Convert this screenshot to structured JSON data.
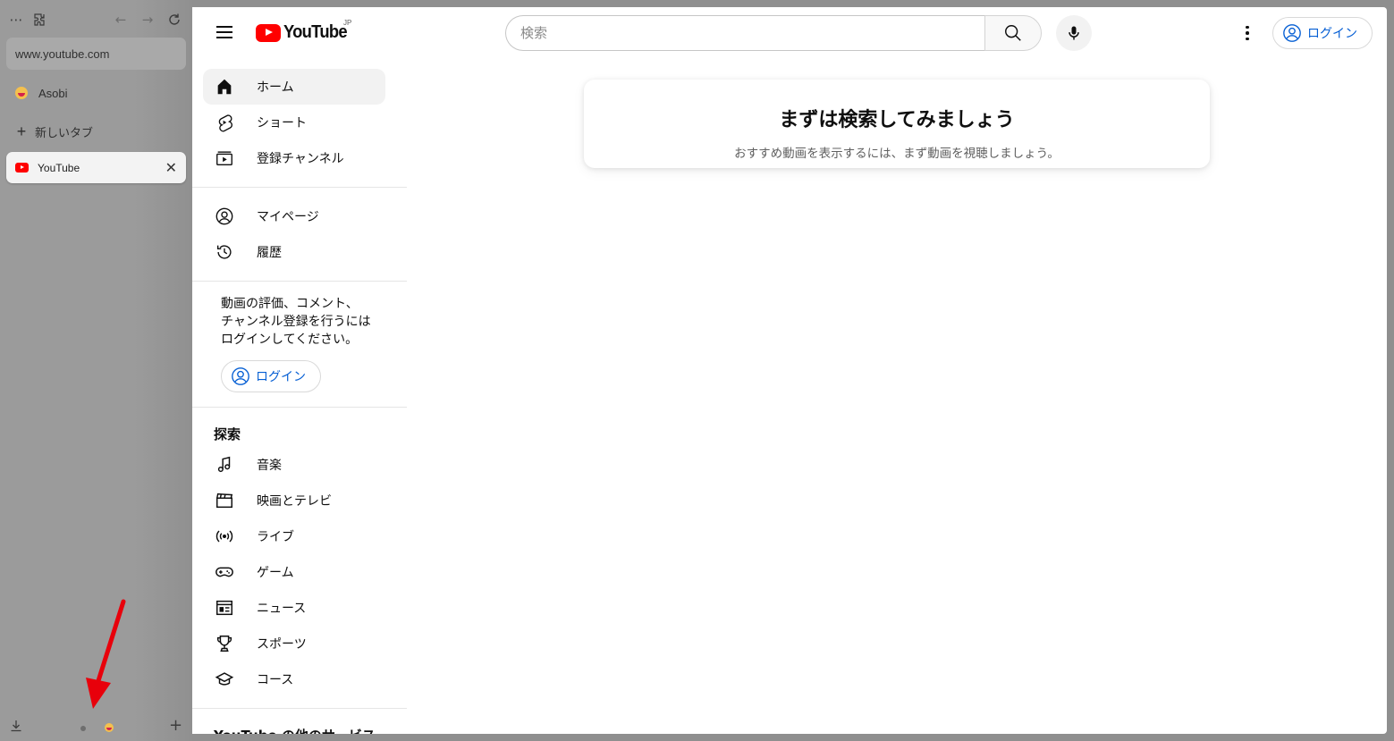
{
  "browser": {
    "url": "www.youtube.com",
    "toolbar_icons": [
      "more-icon",
      "extensions-icon",
      "back-icon",
      "forward-icon",
      "reload-icon"
    ],
    "items": [
      {
        "label": "Asobi",
        "icon": "asobi-emoji-icon"
      },
      {
        "label": "新しいタブ",
        "icon": "plus-icon"
      }
    ],
    "active_tab": {
      "label": "YouTube",
      "icon": "youtube-favicon"
    },
    "bottom_icons": [
      "download-icon",
      "workspace-dot-icon",
      "asobi-emoji-icon",
      "plus-icon"
    ],
    "annotation_arrow_color": "#e8000b"
  },
  "masthead": {
    "logo_text": "YouTube",
    "region": "JP",
    "search_placeholder": "検索",
    "login_label": "ログイン"
  },
  "guide": {
    "primary": [
      {
        "label": "ホーム",
        "icon": "home-icon",
        "active": true
      },
      {
        "label": "ショート",
        "icon": "shorts-icon"
      },
      {
        "label": "登録チャンネル",
        "icon": "subscriptions-icon"
      }
    ],
    "you": [
      {
        "label": "マイページ",
        "icon": "account-icon"
      },
      {
        "label": "履歴",
        "icon": "history-icon"
      }
    ],
    "signin_message": [
      "動画の評価、コメント、",
      "チャンネル登録を行うには",
      "ログインしてください。"
    ],
    "signin_button": "ログイン",
    "explore_heading": "探索",
    "explore": [
      {
        "label": "音楽",
        "icon": "music-icon"
      },
      {
        "label": "映画とテレビ",
        "icon": "movies-icon"
      },
      {
        "label": "ライブ",
        "icon": "live-icon"
      },
      {
        "label": "ゲーム",
        "icon": "gaming-icon"
      },
      {
        "label": "ニュース",
        "icon": "news-icon"
      },
      {
        "label": "スポーツ",
        "icon": "sports-icon"
      },
      {
        "label": "コース",
        "icon": "courses-icon"
      }
    ],
    "more_heading": "YouTube の他のサービス"
  },
  "main": {
    "prompt_title": "まずは検索してみましょう",
    "prompt_subtitle": "おすすめ動画を表示するには、まず動画を視聴しましょう。"
  },
  "colors": {
    "brand_red": "#ff0000",
    "link_blue": "#065fd4",
    "text": "#0f0f0f"
  }
}
